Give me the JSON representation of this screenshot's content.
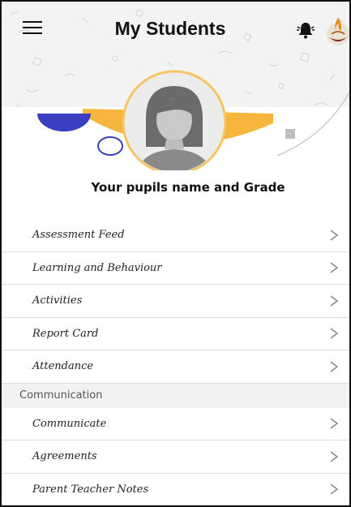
{
  "header": {
    "title": "My Students"
  },
  "icons": {
    "menu": "hamburger-menu-icon",
    "notifications": "bell-icon",
    "brand": "school-crest-icon",
    "avatar": "female-avatar-icon",
    "chevron": "chevron-right-icon"
  },
  "profile": {
    "pupil_label": "Your pupils name and Grade"
  },
  "menu": {
    "items": [
      {
        "label": "Assessment Feed"
      },
      {
        "label": "Learning and Behaviour"
      },
      {
        "label": "Activities"
      },
      {
        "label": "Report Card"
      },
      {
        "label": "Attendance"
      }
    ]
  },
  "communication": {
    "section_title": "Communication",
    "items": [
      {
        "label": "Communicate"
      },
      {
        "label": "Agreements"
      },
      {
        "label": "Parent Teacher Notes"
      }
    ]
  },
  "colors": {
    "accent_yellow": "#f6b63d",
    "accent_blue": "#3a3fbf",
    "chevron": "#888888",
    "divider": "#dcdcdc"
  }
}
